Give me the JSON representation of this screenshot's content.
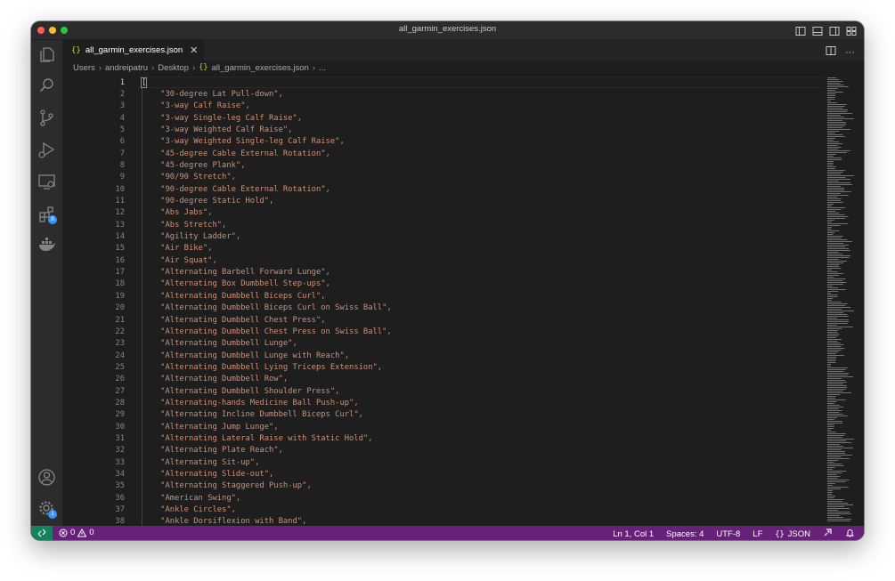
{
  "window": {
    "title": "all_garmin_exercises.json"
  },
  "tab": {
    "label": "all_garmin_exercises.json",
    "icon": "{}"
  },
  "breadcrumb": {
    "items": [
      "Users",
      "andreipatru",
      "Desktop",
      "all_garmin_exercises.json"
    ],
    "icon": "{}",
    "tail": "..."
  },
  "activity_badges": {
    "extensions": "8",
    "settings": "1"
  },
  "editor": {
    "line_numbers": [
      "1",
      "2",
      "3",
      "4",
      "5",
      "6",
      "7",
      "8",
      "9",
      "10",
      "11",
      "12",
      "13",
      "14",
      "15",
      "16",
      "17",
      "18",
      "19",
      "20",
      "21",
      "22",
      "23",
      "24",
      "25",
      "26",
      "27",
      "28",
      "29",
      "30",
      "31",
      "32",
      "33",
      "34",
      "35",
      "36",
      "37",
      "38"
    ],
    "lines": [
      "[",
      "    \"30-degree Lat Pull-down\",",
      "    \"3-way Calf Raise\",",
      "    \"3-way Single-leg Calf Raise\",",
      "    \"3-way Weighted Calf Raise\",",
      "    \"3-way Weighted Single-leg Calf Raise\",",
      "    \"45-degree Cable External Rotation\",",
      "    \"45-degree Plank\",",
      "    \"90/90 Stretch\",",
      "    \"90-degree Cable External Rotation\",",
      "    \"90-degree Static Hold\",",
      "    \"Abs Jabs\",",
      "    \"Abs Stretch\",",
      "    \"Agility Ladder\",",
      "    \"Air Bike\",",
      "    \"Air Squat\",",
      "    \"Alternating Barbell Forward Lunge\",",
      "    \"Alternating Box Dumbbell Step-ups\",",
      "    \"Alternating Dumbbell Biceps Curl\",",
      "    \"Alternating Dumbbell Biceps Curl on Swiss Ball\",",
      "    \"Alternating Dumbbell Chest Press\",",
      "    \"Alternating Dumbbell Chest Press on Swiss Ball\",",
      "    \"Alternating Dumbbell Lunge\",",
      "    \"Alternating Dumbbell Lunge with Reach\",",
      "    \"Alternating Dumbbell Lying Triceps Extension\",",
      "    \"Alternating Dumbbell Row\",",
      "    \"Alternating Dumbbell Shoulder Press\",",
      "    \"Alternating-hands Medicine Ball Push-up\",",
      "    \"Alternating Incline Dumbbell Biceps Curl\",",
      "    \"Alternating Jump Lunge\",",
      "    \"Alternating Lateral Raise with Static Hold\",",
      "    \"Alternating Plate Reach\",",
      "    \"Alternating Sit-up\",",
      "    \"Alternating Slide-out\",",
      "    \"Alternating Staggered Push-up\",",
      "    \"American Swing\",",
      "    \"Ankle Circles\",",
      "    \"Ankle Dorsiflexion with Band\","
    ]
  },
  "statusbar": {
    "errors": "0",
    "warnings": "0",
    "cursor": "Ln 1, Col 1",
    "spaces": "Spaces: 4",
    "encoding": "UTF-8",
    "eol": "LF",
    "language_icon": "{}",
    "language": "JSON"
  },
  "colors": {
    "statusbar": "#68217a",
    "remote": "#16825d",
    "string": "#ce9178",
    "editor_bg": "#1e1e1e",
    "accent_badge": "#3794ff"
  }
}
